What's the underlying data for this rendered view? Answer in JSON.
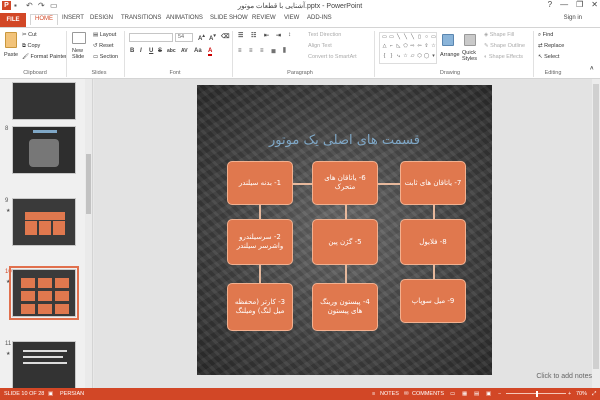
{
  "window": {
    "title": "آشنایی با قطعات موتور.pptx - PowerPoint",
    "controls": [
      "?",
      "—",
      "❐",
      "✕"
    ]
  },
  "tabs": [
    "FILE",
    "HOME",
    "INSERT",
    "DESIGN",
    "TRANSITIONS",
    "ANIMATIONS",
    "SLIDE SHOW",
    "REVIEW",
    "VIEW",
    "ADD-INS"
  ],
  "account": "Sign in",
  "ribbon": {
    "clipboard": {
      "paste": "Paste",
      "cut": "Cut",
      "copy": "Copy",
      "format_painter": "Format Painter",
      "label": "Clipboard"
    },
    "slides": {
      "new_slide": "New Slide",
      "layout": "Layout",
      "reset": "Reset",
      "section": "Section",
      "label": "Slides"
    },
    "font": {
      "size": "54",
      "label": "Font",
      "bold": "B",
      "italic": "I",
      "underline": "U",
      "strike": "S",
      "shadow": "abc",
      "spacing": "AV",
      "case": "Aa",
      "color": "A"
    },
    "paragraph": {
      "text_direction": "Text Direction",
      "align_text": "Align Text",
      "smartart": "Convert to SmartArt",
      "label": "Paragraph"
    },
    "drawing": {
      "arrange": "Arrange",
      "quick_styles": "Quick Styles",
      "shape_fill": "Shape Fill",
      "shape_outline": "Shape Outline",
      "shape_effects": "Shape Effects",
      "label": "Drawing"
    },
    "editing": {
      "find": "Find",
      "replace": "Replace",
      "select": "Select",
      "label": "Editing"
    }
  },
  "thumbnails": [
    {
      "num": "8",
      "star": ""
    },
    {
      "num": "9",
      "star": "★"
    },
    {
      "num": "10",
      "star": "★"
    },
    {
      "num": "11",
      "star": "★"
    }
  ],
  "slide": {
    "title": "قسمت های اصلی یک موتور",
    "boxes": {
      "b1": "1- بدنه سیلندر",
      "b2": "2- سرسیلندرو واشرسر سیلندر",
      "b3": "3- کارتر (محفظه میل لنگ) ومیلنگ",
      "b4": "4- پیستون ورینگ های پیستون",
      "b5": "5- گژن پین",
      "b6": "6- یاتاقان های متحرک",
      "b7": "7- یاتاقان های ثابت",
      "b8": "8- فلایول",
      "b9": "9- میل سوپاپ"
    }
  },
  "notes_placeholder": "Click to add notes",
  "status": {
    "slide": "SLIDE 10 OF 28",
    "language": "PERSIAN",
    "notes": "NOTES",
    "comments": "COMMENTS",
    "zoom": "70%"
  },
  "colors": {
    "accent": "#d24726",
    "box": "#e0784e"
  }
}
